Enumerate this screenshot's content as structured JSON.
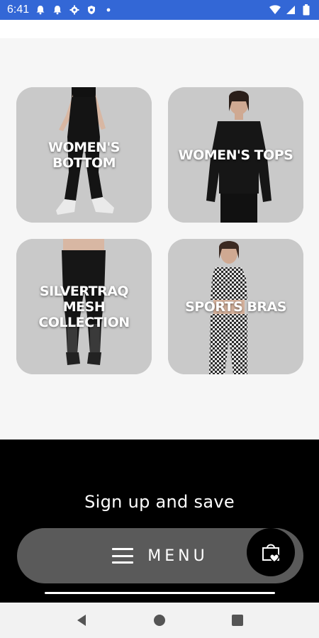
{
  "status_bar": {
    "time": "6:41",
    "notification_icons": [
      "bell-icon",
      "bell-icon",
      "gear-icon",
      "shield-icon",
      "dot-icon"
    ],
    "system_icons": [
      "wifi-icon",
      "signal-icon",
      "battery-icon"
    ]
  },
  "categories": [
    {
      "label": "WOMEN'S\nBOTTOM"
    },
    {
      "label": "WOMEN'S TOPS"
    },
    {
      "label": "SILVERTRAQ\nMESH\nCOLLECTION"
    },
    {
      "label": "SPORTS BRAS"
    }
  ],
  "footer": {
    "signup_text": "Sign up and save"
  },
  "menu": {
    "label": "MENU",
    "icon": "hamburger-icon"
  },
  "cart": {
    "icon": "shopping-bag-heart-icon"
  },
  "nav_bar": {
    "icons": [
      "back-icon",
      "home-icon",
      "recents-icon"
    ]
  },
  "colors": {
    "status_bar": "#3367d6",
    "tile_bg": "#c8c8c8",
    "footer_bg": "#000000",
    "menu_bg": "#5a5a5a"
  }
}
